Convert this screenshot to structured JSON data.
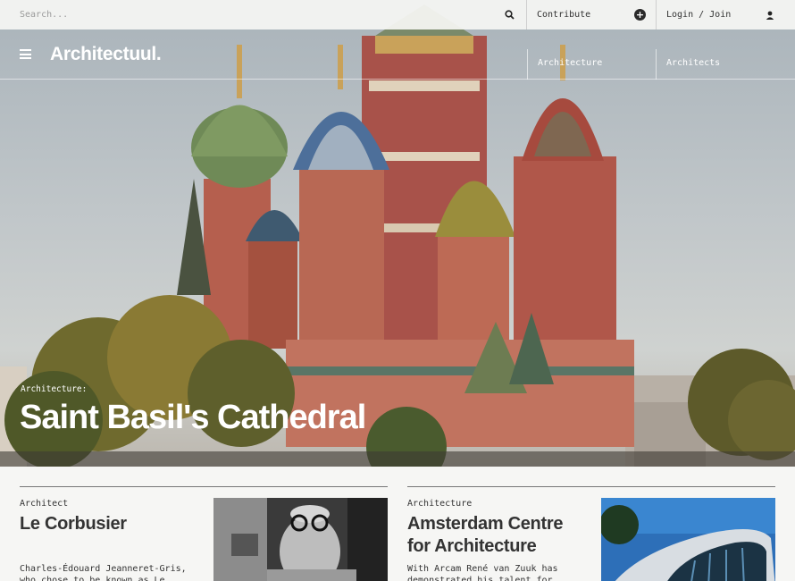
{
  "search": {
    "placeholder": "Search..."
  },
  "topbar": {
    "contribute_label": "Contribute",
    "login_label": "Login / Join"
  },
  "brand": {
    "logo": "Architectuul."
  },
  "nav": {
    "items": [
      {
        "label": "Architecture"
      },
      {
        "label": "Architects"
      }
    ]
  },
  "hero": {
    "category": "Architecture:",
    "title": "Saint Basil's Cathedral"
  },
  "cards": [
    {
      "category": "Architect",
      "title": "Le Corbusier",
      "excerpt": "Charles-Édouard Jeanneret-Gris, who chose to be known as Le"
    },
    {
      "category": "Architecture",
      "title": "Amsterdam Centre for Architecture",
      "excerpt": "With Arcam René van Zuuk has demonstrated his talent for"
    }
  ],
  "colors": {
    "text": "#333333",
    "topbar_bg": "#f6f6f4",
    "page_bg": "#f6f6f4"
  }
}
